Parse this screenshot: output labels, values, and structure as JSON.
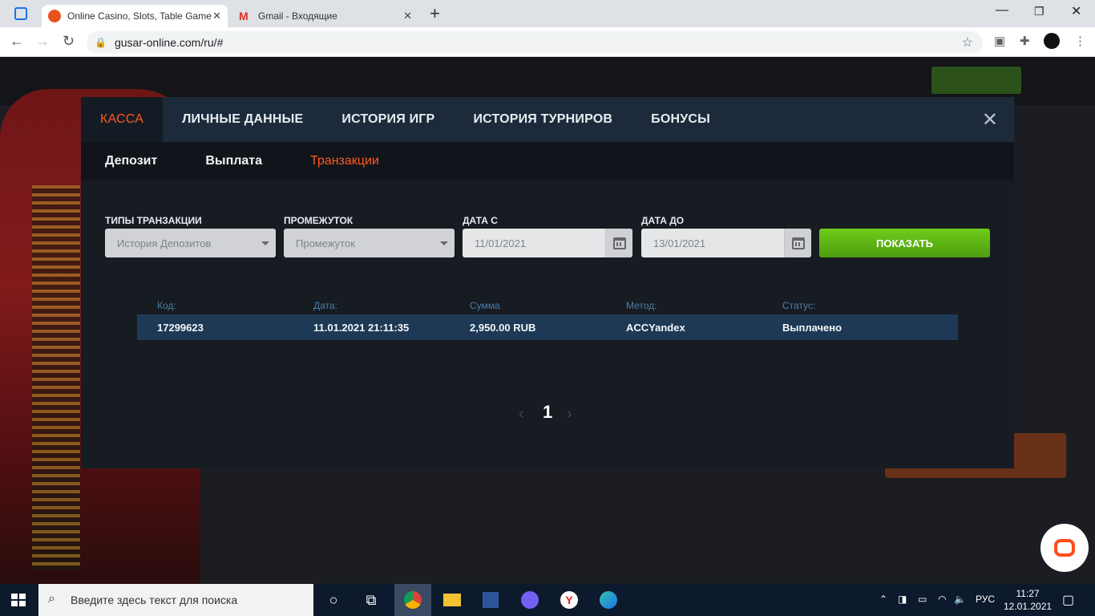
{
  "browser": {
    "tabs": [
      {
        "title": "Online Casino, Slots, Table Game",
        "active": true
      },
      {
        "title": "Gmail - Входящие",
        "active": false
      }
    ],
    "url": "gusar-online.com/ru/#"
  },
  "modal": {
    "top_nav": [
      "КАССА",
      "ЛИЧНЫЕ ДАННЫЕ",
      "ИСТОРИЯ ИГР",
      "ИСТОРИЯ ТУРНИРОВ",
      "БОНУСЫ"
    ],
    "active_top": "КАССА",
    "sub_nav": [
      "Депозит",
      "Выплата",
      "Транзакции"
    ],
    "active_sub": "Транзакции",
    "filters": {
      "type_label": "ТИПЫ ТРАНЗАКЦИИ",
      "type_value": "История Депозитов",
      "period_label": "ПРОМЕЖУТОК",
      "period_value": "Промежуток",
      "from_label": "ДАТА С",
      "from_value": "11/01/2021",
      "to_label": "ДАТА ДО",
      "to_value": "13/01/2021",
      "show_label": "ПОКАЗАТЬ"
    },
    "table": {
      "headers": [
        "Код:",
        "Дата:",
        "Сумма",
        "Метод:",
        "Статус:"
      ],
      "rows": [
        [
          "17299623",
          "11.01.2021 21:11:35",
          "2,950.00 RUB",
          "ACCYandex",
          "Выплачено"
        ]
      ]
    },
    "pagination": {
      "current": "1",
      "prev": "‹",
      "next": "›"
    },
    "close": "✕"
  },
  "taskbar": {
    "search_placeholder": "Введите здесь текст для поиска",
    "lang": "РУС",
    "time": "11:27",
    "date": "12.01.2021"
  },
  "colors": {
    "accent": "#ff5a1f",
    "show_button": "#5cb315",
    "row": "#1d3956"
  }
}
